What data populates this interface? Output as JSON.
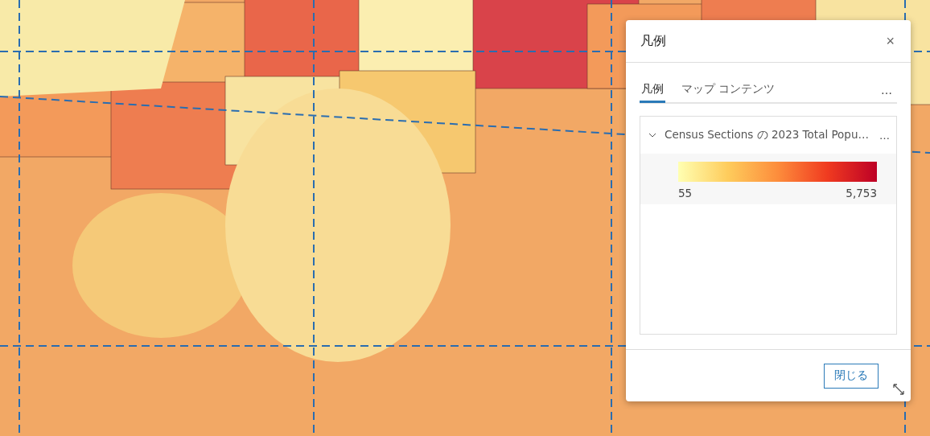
{
  "legend_panel": {
    "title": "凡例",
    "close": "×",
    "tabs": [
      {
        "label": "凡例",
        "selected": true
      },
      {
        "label": "マップ コンテンツ",
        "selected": false
      }
    ],
    "tabs_more": "…",
    "layer": {
      "title": "Census Sections の 2023 Total Popu…",
      "expanded": true,
      "more": "…",
      "ramp_min": "55",
      "ramp_max": "5,753"
    },
    "close_button": "閉じる"
  }
}
